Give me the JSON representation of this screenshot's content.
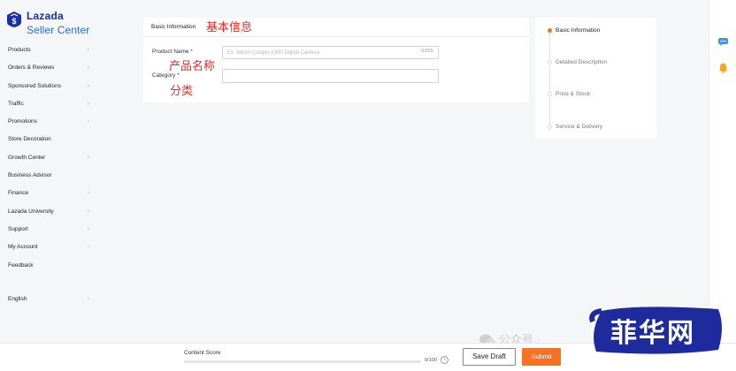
{
  "brand": {
    "line1": "Lazada",
    "line2": "Seller Center",
    "badge_color": "#1a2fa0"
  },
  "sidebar": {
    "items": [
      {
        "label": "Products",
        "has_chevron": true
      },
      {
        "label": "Orders & Reviews",
        "has_chevron": true
      },
      {
        "label": "Sponsored Solutions",
        "has_chevron": true
      },
      {
        "label": "Traffic",
        "has_chevron": true
      },
      {
        "label": "Promotions",
        "has_chevron": true
      },
      {
        "label": "Store Decoration",
        "has_chevron": false
      },
      {
        "label": "Growth Center",
        "has_chevron": true
      },
      {
        "label": "Business Advisor",
        "has_chevron": false
      },
      {
        "label": "Finance",
        "has_chevron": true
      },
      {
        "label": "Lazada University",
        "has_chevron": true
      },
      {
        "label": "Support",
        "has_chevron": true
      },
      {
        "label": "My Account",
        "has_chevron": true
      },
      {
        "label": "Feedback",
        "has_chevron": false
      }
    ],
    "language": "English"
  },
  "form": {
    "section_title": "Basic Information",
    "product_name_label": "Product Name *",
    "product_name_placeholder": "Ex. Nikon Coolpix A300 Digital Camera",
    "product_name_value": "",
    "product_name_counter": "0/255",
    "category_label": "Category *",
    "category_value": ""
  },
  "annotations": {
    "section": "基本信息",
    "product_name": "产品名称",
    "category": "分类",
    "color": "#e8282a"
  },
  "steps": [
    {
      "label": "Basic Information",
      "active": true
    },
    {
      "label": "Detailed Description",
      "active": false
    },
    {
      "label": "Price & Stock",
      "active": false
    },
    {
      "label": "Service & Delivery",
      "active": false
    }
  ],
  "footer": {
    "content_score_label": "Content Score",
    "content_score_value": "0/100",
    "content_score_fraction": 0,
    "save_draft": "Save Draft",
    "submit": "Submit",
    "accent": "#f57224"
  },
  "watermarks": {
    "wechat_text": "公众号 ·",
    "logo_text": "菲华网"
  },
  "icons": {
    "chat": "chat-bubble-icon",
    "bell": "bell-icon",
    "info": "info-icon",
    "chevron": "chevron-right-icon"
  }
}
